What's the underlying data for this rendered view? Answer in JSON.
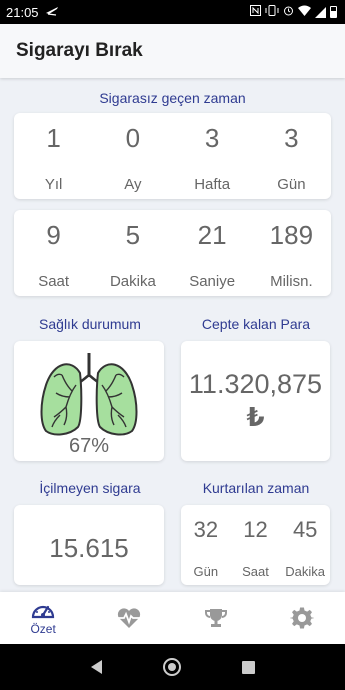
{
  "status_bar": {
    "time": "21:05"
  },
  "app_bar": {
    "title": "Sigarayı Bırak"
  },
  "smoke_free_time": {
    "title": "Sigarasız geçen zaman",
    "row1": [
      {
        "value": "1",
        "label": "Yıl"
      },
      {
        "value": "0",
        "label": "Ay"
      },
      {
        "value": "3",
        "label": "Hafta"
      },
      {
        "value": "3",
        "label": "Gün"
      }
    ],
    "row2": [
      {
        "value": "9",
        "label": "Saat"
      },
      {
        "value": "5",
        "label": "Dakika"
      },
      {
        "value": "21",
        "label": "Saniye"
      },
      {
        "value": "189",
        "label": "Milisn."
      }
    ]
  },
  "health": {
    "title": "Sağlık durumum",
    "percent_text": "67%",
    "percent": 67,
    "icon": "lungs-icon",
    "lung_color": "#a6df9e"
  },
  "money": {
    "title": "Cepte kalan Para",
    "amount": "11.320,875",
    "currency": "₺"
  },
  "unsmoked": {
    "title": "İçilmeyen sigara",
    "count": "15.615"
  },
  "saved_time": {
    "title": "Kurtarılan zaman",
    "items": [
      {
        "value": "32",
        "label": "Gün"
      },
      {
        "value": "12",
        "label": "Saat"
      },
      {
        "value": "45",
        "label": "Dakika"
      }
    ]
  },
  "bottom_nav": {
    "items": [
      {
        "label": "Özet",
        "icon": "speedometer-icon",
        "active": true
      },
      {
        "label": "",
        "icon": "heart-pulse-icon",
        "active": false
      },
      {
        "label": "",
        "icon": "trophy-icon",
        "active": false
      },
      {
        "label": "",
        "icon": "gear-icon",
        "active": false
      }
    ]
  },
  "colors": {
    "accent": "#2f3b91",
    "background": "#eef1f6",
    "card": "#ffffff",
    "text": "#666666"
  }
}
